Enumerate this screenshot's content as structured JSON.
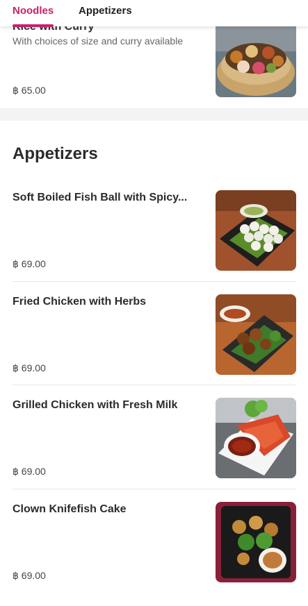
{
  "tabs": [
    {
      "label": "Noodles",
      "active": true
    },
    {
      "label": "Appetizers",
      "active": false
    }
  ],
  "partial_item": {
    "title": "Rice with Curry",
    "description": "With choices of size and curry available",
    "price": "฿ 65.00",
    "image": "curry-set-basket-photo"
  },
  "section": {
    "heading": "Appetizers",
    "items": [
      {
        "title": "Soft Boiled Fish Ball with Spicy...",
        "price": "฿ 69.00",
        "image": "fish-ball-photo"
      },
      {
        "title": "Fried Chicken with Herbs",
        "price": "฿ 69.00",
        "image": "fried-chicken-photo"
      },
      {
        "title": "Grilled Chicken with Fresh Milk",
        "price": "฿ 69.00",
        "image": "grilled-chicken-photo"
      },
      {
        "title": "Clown Knifefish Cake",
        "price": "฿ 69.00",
        "image": "fish-cake-photo"
      }
    ]
  },
  "colors": {
    "accent": "#c8226b",
    "text": "#2b2b2b",
    "muted": "#666666"
  }
}
